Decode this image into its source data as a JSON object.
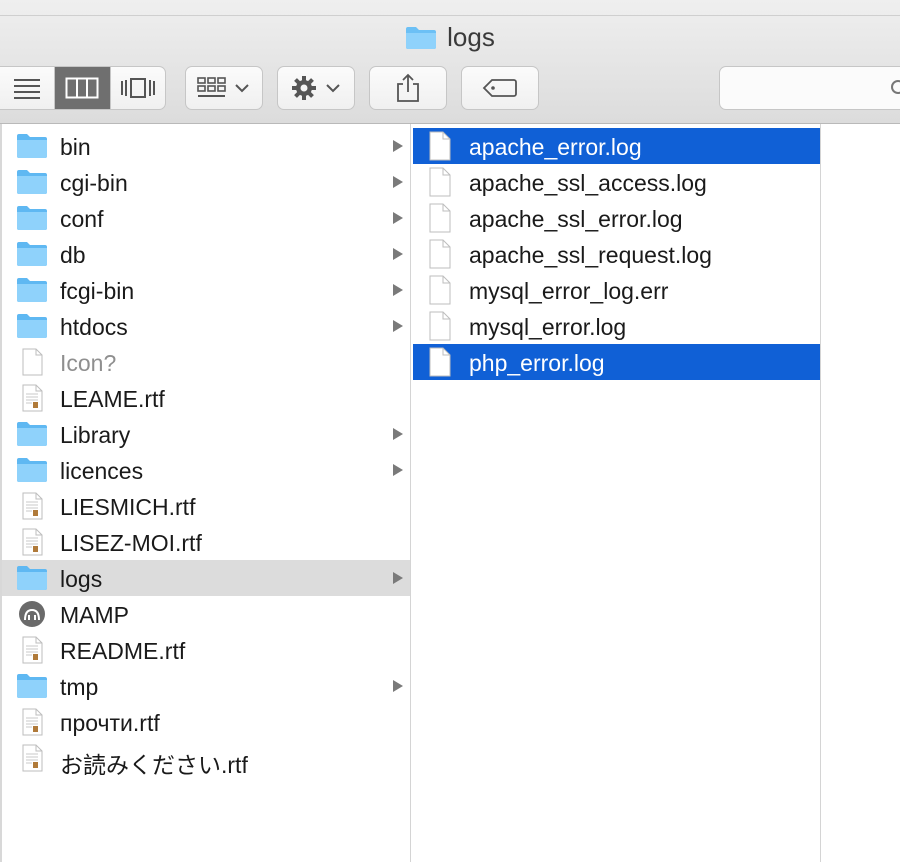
{
  "window": {
    "title": "logs"
  },
  "toolbar": {
    "view_modes": [
      "list-view",
      "column-view",
      "cover-flow-view"
    ],
    "active_view": "column-view",
    "arrange_icon": "grid-icon",
    "action_icon": "gear-icon",
    "share_icon": "share-icon",
    "tag_icon": "tag-icon",
    "search_placeholder": ""
  },
  "colors": {
    "selection": "#1060d6",
    "inactive_selection": "#dcdcdc",
    "folder": "#6cc0f5"
  },
  "column1": {
    "items": [
      {
        "label": "bin",
        "kind": "folder",
        "has_children": true
      },
      {
        "label": "cgi-bin",
        "kind": "folder",
        "has_children": true
      },
      {
        "label": "conf",
        "kind": "folder",
        "has_children": true
      },
      {
        "label": "db",
        "kind": "folder",
        "has_children": true
      },
      {
        "label": "fcgi-bin",
        "kind": "folder",
        "has_children": true
      },
      {
        "label": "htdocs",
        "kind": "folder",
        "has_children": true
      },
      {
        "label": "Icon?",
        "kind": "blank",
        "has_children": false
      },
      {
        "label": "LEAME.rtf",
        "kind": "rtf",
        "has_children": false
      },
      {
        "label": "Library",
        "kind": "folder",
        "has_children": true
      },
      {
        "label": "licences",
        "kind": "folder",
        "has_children": true
      },
      {
        "label": "LIESMICH.rtf",
        "kind": "rtf",
        "has_children": false
      },
      {
        "label": "LISEZ-MOI.rtf",
        "kind": "rtf",
        "has_children": false
      },
      {
        "label": "logs",
        "kind": "folder",
        "has_children": true,
        "selected": true
      },
      {
        "label": "MAMP",
        "kind": "app",
        "has_children": false
      },
      {
        "label": "README.rtf",
        "kind": "rtf",
        "has_children": false
      },
      {
        "label": "tmp",
        "kind": "folder",
        "has_children": true
      },
      {
        "label": "прочти.rtf",
        "kind": "rtf",
        "has_children": false
      },
      {
        "label": "お読みください.rtf",
        "kind": "rtf",
        "has_children": false
      }
    ]
  },
  "column2": {
    "items": [
      {
        "label": "apache_error.log",
        "selected": true
      },
      {
        "label": "apache_ssl_access.log",
        "selected": false
      },
      {
        "label": "apache_ssl_error.log",
        "selected": false
      },
      {
        "label": "apache_ssl_request.log",
        "selected": false
      },
      {
        "label": "mysql_error_log.err",
        "selected": false
      },
      {
        "label": "mysql_error.log",
        "selected": false
      },
      {
        "label": "php_error.log",
        "selected": true
      }
    ]
  }
}
